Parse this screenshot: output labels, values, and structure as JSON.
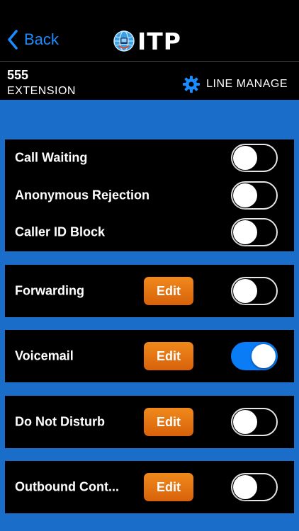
{
  "nav": {
    "back_label": "Back",
    "logo_text": "ITP"
  },
  "extension": {
    "number": "555",
    "label": "EXTENSION",
    "line_manage_label": "LINE MANAGE"
  },
  "colors": {
    "accent_blue": "#1a8cff",
    "content_bg": "#1a6dc9",
    "edit_orange": "#e4730f",
    "toggle_on": "#0a7cf5"
  },
  "settings": {
    "call_waiting": {
      "label": "Call Waiting",
      "enabled": false
    },
    "anonymous_rejection": {
      "label": "Anonymous Rejection",
      "enabled": false
    },
    "caller_id_block": {
      "label": "Caller ID Block",
      "enabled": false
    },
    "forwarding": {
      "label": "Forwarding",
      "edit_label": "Edit",
      "enabled": false
    },
    "voicemail": {
      "label": "Voicemail",
      "edit_label": "Edit",
      "enabled": true
    },
    "do_not_disturb": {
      "label": "Do Not Disturb",
      "edit_label": "Edit",
      "enabled": false
    },
    "outbound_control": {
      "label": "Outbound Cont...",
      "edit_label": "Edit",
      "enabled": false
    }
  }
}
